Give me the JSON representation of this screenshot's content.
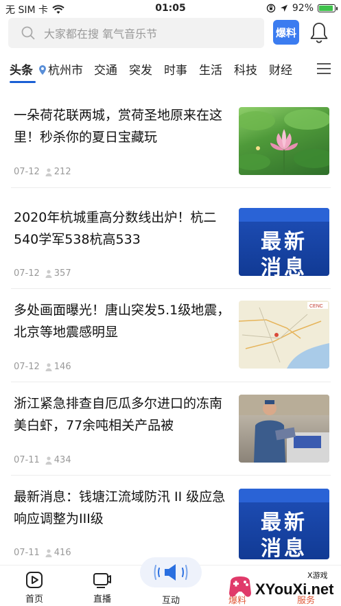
{
  "status_bar": {
    "carrier": "无 SIM 卡",
    "time": "01:05",
    "battery": "92%",
    "battery_level": 0.92
  },
  "search": {
    "placeholder": "大家都在搜 氧气音乐节",
    "baoliao_label": "爆料"
  },
  "tabs": [
    {
      "label": "头条"
    },
    {
      "label": "杭州市"
    },
    {
      "label": "交通"
    },
    {
      "label": "突发"
    },
    {
      "label": "时事"
    },
    {
      "label": "生活"
    },
    {
      "label": "科技"
    },
    {
      "label": "财经"
    }
  ],
  "articles": [
    {
      "title": "一朵荷花联两城，赏荷圣地原来在这里！秒杀你的夏日宝藏玩",
      "date": "07-12",
      "views": "212",
      "thumb": "lotus"
    },
    {
      "title": "2020年杭城重高分数线出炉！杭二540学军538杭高533",
      "date": "07-12",
      "views": "357",
      "thumb": "news",
      "thumb_text": [
        "最新",
        "消息"
      ]
    },
    {
      "title": "多处画面曝光！唐山突发5.1级地震，北京等地震感明显",
      "date": "07-12",
      "views": "146",
      "thumb": "map",
      "thumb_text": [
        "CENC"
      ]
    },
    {
      "title": "浙江紧急排查自厄瓜多尔进口的冻南美白虾，77余吨相关产品被",
      "date": "07-11",
      "views": "434",
      "thumb": "photo"
    },
    {
      "title": "最新消息：钱塘江流域防汛 II 级应急响应调整为III级",
      "date": "07-11",
      "views": "416",
      "thumb": "news",
      "thumb_text": [
        "最新",
        "消息"
      ]
    }
  ],
  "bottom_nav": [
    {
      "label": "首页",
      "icon": "play-icon"
    },
    {
      "label": "直播",
      "icon": "live-icon"
    },
    {
      "label": "互动",
      "icon": "megaphone-icon"
    },
    {
      "label": "爆料",
      "icon": "report-icon"
    },
    {
      "label": "服务",
      "icon": "service-icon"
    }
  ],
  "watermark": {
    "brand": "XYouXi.net",
    "small": "X游戏"
  },
  "colors": {
    "accent": "#1a5fd4",
    "baoliao_bg": "#3b7cf0",
    "battery": "#3ec24b"
  }
}
